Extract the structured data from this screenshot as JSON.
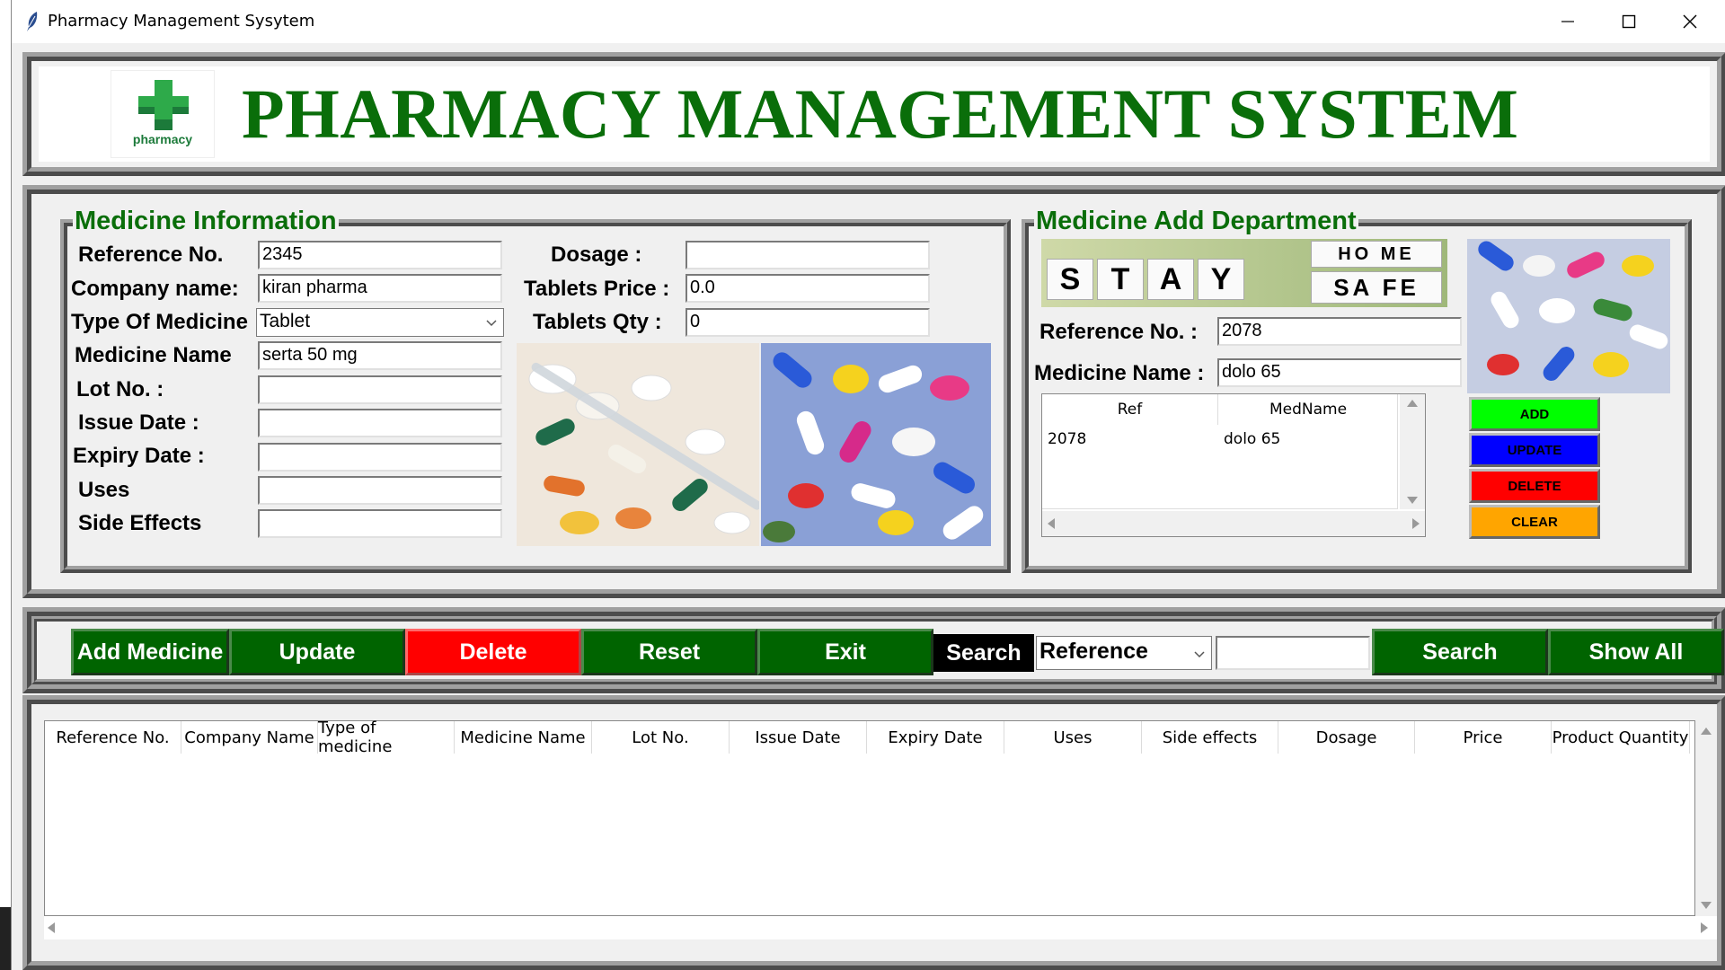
{
  "window": {
    "title": "Pharmacy Management Sysytem"
  },
  "header": {
    "title": "PHARMACY MANAGEMENT SYSTEM",
    "logo_text": "pharmacy"
  },
  "medicine_info": {
    "title": "Medicine Information",
    "fields": {
      "reference_no": {
        "label": "Reference No.",
        "value": "2345"
      },
      "company_name": {
        "label": "Company name:",
        "value": "kiran pharma"
      },
      "type_of_medicine": {
        "label": "Type Of Medicine",
        "value": "Tablet"
      },
      "medicine_name": {
        "label": "Medicine Name",
        "value": "serta 50 mg"
      },
      "lot_no": {
        "label": "Lot No.  :",
        "value": ""
      },
      "issue_date": {
        "label": "Issue Date :",
        "value": ""
      },
      "expiry_date": {
        "label": "Expiry Date :",
        "value": ""
      },
      "uses": {
        "label": "Uses",
        "value": ""
      },
      "side_effects": {
        "label": "Side Effects",
        "value": ""
      },
      "dosage": {
        "label": "Dosage :",
        "value": ""
      },
      "tablets_price": {
        "label": "Tablets Price :",
        "value": "0.0"
      },
      "tablets_qty": {
        "label": "Tablets Qty :",
        "value": "0"
      }
    }
  },
  "add_dept": {
    "title": "Medicine Add Department",
    "banner": {
      "word1": [
        "S",
        "T",
        "A",
        "Y"
      ],
      "home": "HO ME",
      "safe": "SA FE"
    },
    "reference_no": {
      "label": "Reference No. :",
      "value": "2078"
    },
    "medicine_name": {
      "label": "Medicine Name :",
      "value": "dolo 65"
    },
    "list": {
      "headers": [
        "Ref",
        "MedName"
      ],
      "rows": [
        {
          "ref": "2078",
          "medname": "dolo 65"
        }
      ]
    },
    "buttons": {
      "add": "ADD",
      "update": "UPDATE",
      "delete": "DELETE",
      "clear": "CLEAR"
    },
    "colors": {
      "add": "#00ff00",
      "update": "#0000ff",
      "delete": "#ff0000",
      "clear": "#ffa500"
    }
  },
  "toolbar": {
    "add_medicine": "Add Medicine",
    "update": "Update",
    "delete": "Delete",
    "reset": "Reset",
    "exit": "Exit",
    "search_label": "Search",
    "search_by": "Reference",
    "search_value": "",
    "search": "Search",
    "show_all": "Show All"
  },
  "table": {
    "headers": [
      "Reference No.",
      "Company Name",
      "Type of medicine",
      "Medicine Name",
      "Lot No.",
      "Issue Date",
      "Expiry Date",
      "Uses",
      "Side effects",
      "Dosage",
      "Price",
      "Product Quantity"
    ],
    "rows": []
  },
  "colors": {
    "title_green": "#0a6e0a",
    "button_green": "#006400",
    "delete_red": "#ff0000",
    "search_black": "#000000"
  }
}
